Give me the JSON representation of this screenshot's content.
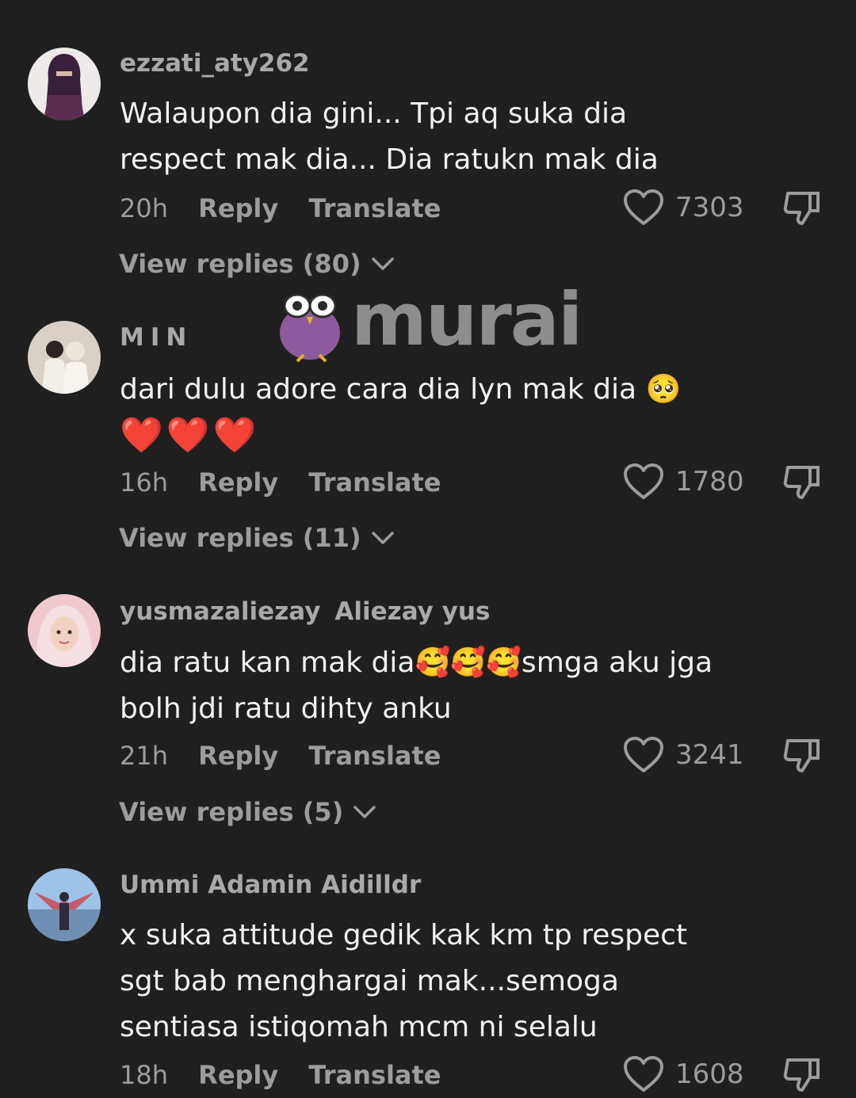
{
  "comments": [
    {
      "username": "ezzati_aty262",
      "nickname": "",
      "text": "Walaupon dia gini... Tpi aq suka dia respect mak dia... Dia ratukn mak dia",
      "time": "20h",
      "reply_label": "Reply",
      "translate_label": "Translate",
      "likes": "7303",
      "view_replies": "View replies (80)"
    },
    {
      "username": "MIN",
      "nickname": "",
      "text": "dari dulu adore cara dia lyn mak dia 🥺",
      "text_extra": "❤️❤️❤️",
      "time": "16h",
      "reply_label": "Reply",
      "translate_label": "Translate",
      "likes": "1780",
      "view_replies": "View replies (11)"
    },
    {
      "username": "yusmazaliezay",
      "nickname": "Aliezay yus",
      "text": "dia ratu kan mak dia🥰🥰🥰smga aku jga bolh jdi ratu dihty anku",
      "time": "21h",
      "reply_label": "Reply",
      "translate_label": "Translate",
      "likes": "3241",
      "view_replies": "View replies (5)"
    },
    {
      "username": "Ummi Adamin Aidilldr",
      "nickname": "",
      "text": "x suka attitude gedik kak km tp respect sgt bab menghargai mak...semoga sentiasa istiqomah mcm ni selalu",
      "time": "18h",
      "reply_label": "Reply",
      "translate_label": "Translate",
      "likes": "1608",
      "view_replies": ""
    }
  ],
  "watermark": {
    "text": "murai"
  },
  "colors": {
    "background": "#1f1f1f",
    "text": "#f2f2f2",
    "muted": "#9c9c9c",
    "watermark_bird": "#8e5a9e"
  }
}
